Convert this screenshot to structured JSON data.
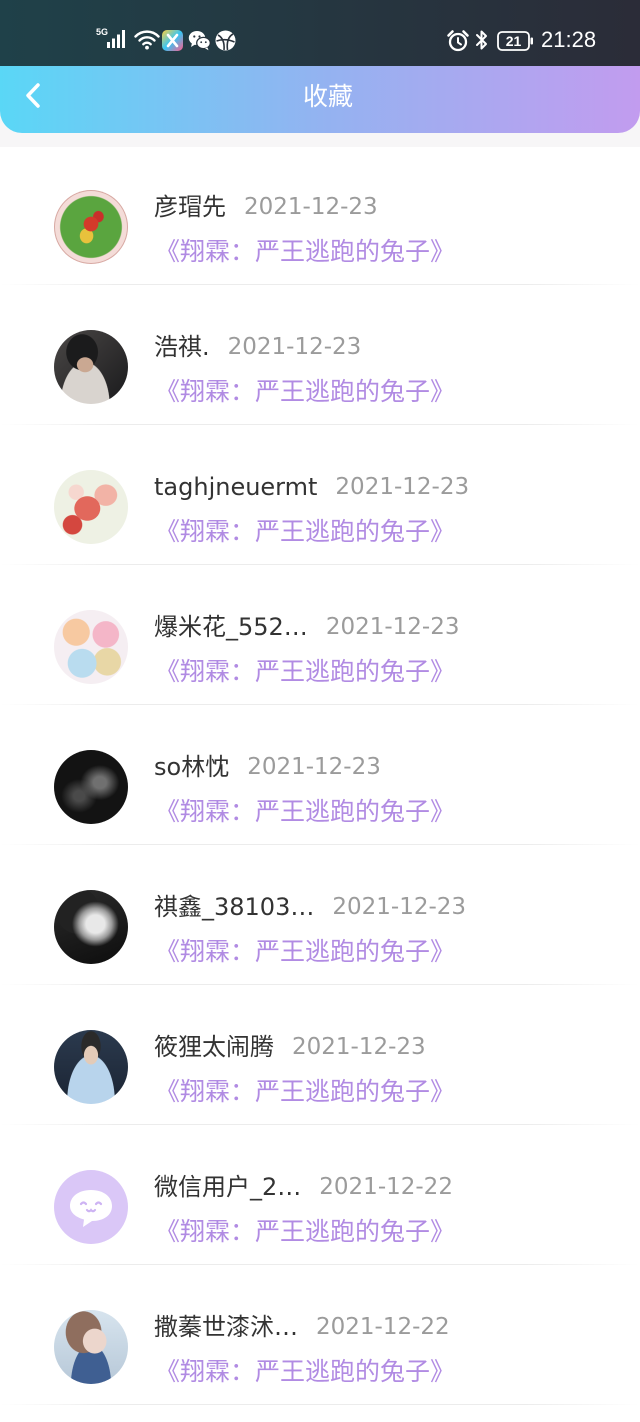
{
  "status_bar": {
    "network_label": "5G",
    "battery_level": "21",
    "time": "21:28",
    "left_icons": [
      "signal-icon",
      "wifi-icon",
      "app-notification-icon",
      "wechat-icon",
      "browser-icon"
    ],
    "right_icons": [
      "alarm-icon",
      "bluetooth-icon",
      "battery-icon"
    ]
  },
  "header": {
    "back_icon": "chevron-left-icon",
    "title": "收藏"
  },
  "favorites": [
    {
      "name": "彦瑁先",
      "date": "2021-12-23",
      "work_title": "《翔霖：严王逃跑的兔子》"
    },
    {
      "name": "浩祺.",
      "date": "2021-12-23",
      "work_title": "《翔霖：严王逃跑的兔子》"
    },
    {
      "name": "taghjneuermt",
      "date": "2021-12-23",
      "work_title": "《翔霖：严王逃跑的兔子》"
    },
    {
      "name": "爆米花_552…",
      "date": "2021-12-23",
      "work_title": "《翔霖：严王逃跑的兔子》"
    },
    {
      "name": "so林忱",
      "date": "2021-12-23",
      "work_title": "《翔霖：严王逃跑的兔子》"
    },
    {
      "name": "祺鑫_38103…",
      "date": "2021-12-23",
      "work_title": "《翔霖：严王逃跑的兔子》"
    },
    {
      "name": "筱狸太闹腾",
      "date": "2021-12-23",
      "work_title": "《翔霖：严王逃跑的兔子》"
    },
    {
      "name": "微信用户_2…",
      "date": "2021-12-22",
      "work_title": "《翔霖：严王逃跑的兔子》",
      "avatar_icon": "chat-bubble-face-icon"
    },
    {
      "name": "撒蓁世漆沭…",
      "date": "2021-12-22",
      "work_title": "《翔霖：严王逃跑的兔子》"
    }
  ],
  "colors": {
    "status_bar_start": "#1f4149",
    "status_bar_end": "#2b2c38",
    "header_gradient_start": "#5ad7f6",
    "header_gradient_mid": "#93b3f1",
    "header_gradient_end": "#c29cef",
    "name_text": "#333333",
    "date_text": "#9b9b9b",
    "work_title_text": "#b18be3",
    "default_avatar_bg": "#dac7f7",
    "page_background": "#f7f6f7"
  }
}
